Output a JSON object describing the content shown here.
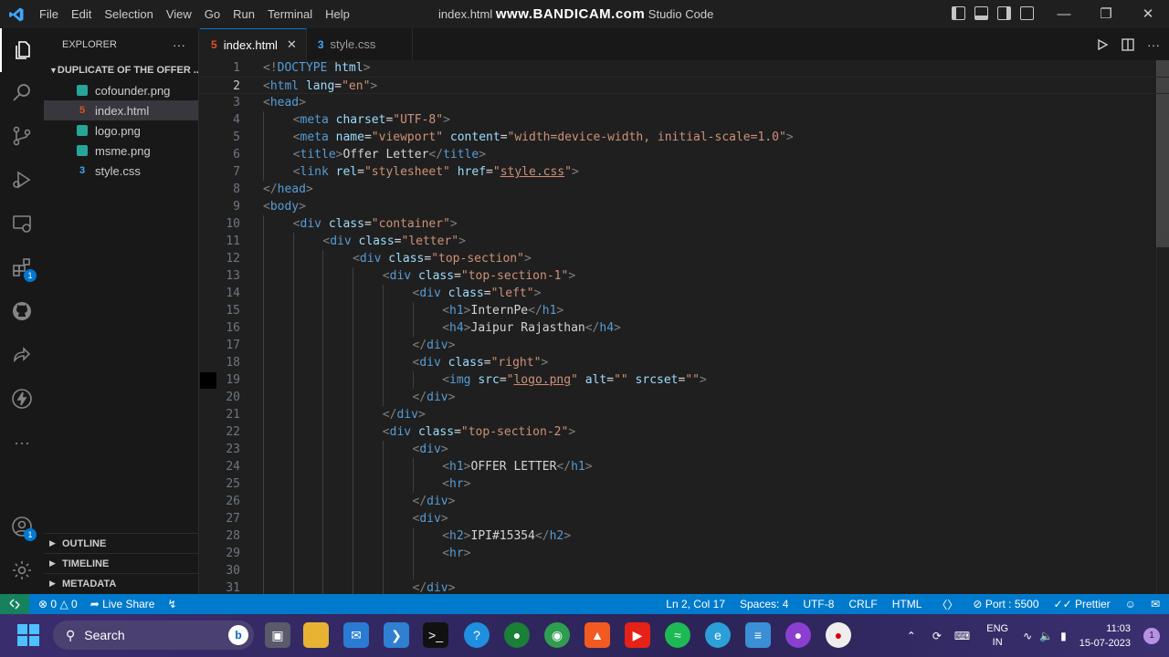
{
  "window": {
    "title_prefix": "index.html",
    "watermark": "www.BANDICAM.com",
    "title_suffix": "Studio Code",
    "menu": [
      "File",
      "Edit",
      "Selection",
      "View",
      "Go",
      "Run",
      "Terminal",
      "Help"
    ]
  },
  "activity": {
    "extensions_badge": "1",
    "accounts_badge": "1"
  },
  "explorer": {
    "header": "EXPLORER",
    "more": "···",
    "folder": "DUPLICATE OF THE OFFER ...",
    "files": [
      {
        "name": "cofounder.png",
        "type": "png"
      },
      {
        "name": "index.html",
        "type": "html"
      },
      {
        "name": "logo.png",
        "type": "png"
      },
      {
        "name": "msme.png",
        "type": "png"
      },
      {
        "name": "style.css",
        "type": "css"
      }
    ],
    "sections": [
      "OUTLINE",
      "TIMELINE",
      "METADATA"
    ]
  },
  "tabs": [
    {
      "label": "index.html",
      "active": true
    },
    {
      "label": "style.css",
      "active": false
    }
  ],
  "editor": {
    "current_line": 2,
    "lines": [
      {
        "n": "1",
        "indent": 0,
        "html": "<span class='b'>&lt;!</span><span class='t'>DOCTYPE</span> <span class='a'>html</span><span class='b'>&gt;</span>"
      },
      {
        "n": "2",
        "indent": 0,
        "html": "<span class='b'>&lt;</span><span class='t'>html</span> <span class='a'>lang</span><span class='w'>=</span><span class='s'>\"en\"</span><span class='b'>&gt;</span>"
      },
      {
        "n": "3",
        "indent": 0,
        "html": "<span class='b'>&lt;</span><span class='t'>head</span><span class='b'>&gt;</span>"
      },
      {
        "n": "4",
        "indent": 1,
        "html": "<span class='b'>&lt;</span><span class='t'>meta</span> <span class='a'>charset</span><span class='w'>=</span><span class='s'>\"UTF-8\"</span><span class='b'>&gt;</span>"
      },
      {
        "n": "5",
        "indent": 1,
        "html": "<span class='b'>&lt;</span><span class='t'>meta</span> <span class='a'>name</span><span class='w'>=</span><span class='s'>\"viewport\"</span> <span class='a'>content</span><span class='w'>=</span><span class='s'>\"width=device-width, initial-scale=1.0\"</span><span class='b'>&gt;</span>"
      },
      {
        "n": "6",
        "indent": 1,
        "html": "<span class='b'>&lt;</span><span class='t'>title</span><span class='b'>&gt;</span><span class='w'>Offer Letter</span><span class='b'>&lt;/</span><span class='t'>title</span><span class='b'>&gt;</span>"
      },
      {
        "n": "7",
        "indent": 1,
        "html": "<span class='b'>&lt;</span><span class='t'>link</span> <span class='a'>rel</span><span class='w'>=</span><span class='s'>\"stylesheet\"</span> <span class='a'>href</span><span class='w'>=</span><span class='s'>\"<span class='u'>style.css</span>\"</span><span class='b'>&gt;</span>"
      },
      {
        "n": "8",
        "indent": 0,
        "html": "<span class='b'>&lt;/</span><span class='t'>head</span><span class='b'>&gt;</span>"
      },
      {
        "n": "9",
        "indent": 0,
        "html": "<span class='b'>&lt;</span><span class='t'>body</span><span class='b'>&gt;</span>"
      },
      {
        "n": "10",
        "indent": 1,
        "html": "<span class='b'>&lt;</span><span class='t'>div</span> <span class='a'>class</span><span class='w'>=</span><span class='s'>\"container\"</span><span class='b'>&gt;</span>"
      },
      {
        "n": "11",
        "indent": 2,
        "html": "<span class='b'>&lt;</span><span class='t'>div</span> <span class='a'>class</span><span class='w'>=</span><span class='s'>\"letter\"</span><span class='b'>&gt;</span>"
      },
      {
        "n": "12",
        "indent": 3,
        "html": "<span class='b'>&lt;</span><span class='t'>div</span> <span class='a'>class</span><span class='w'>=</span><span class='s'>\"top-section\"</span><span class='b'>&gt;</span>"
      },
      {
        "n": "13",
        "indent": 4,
        "html": "<span class='b'>&lt;</span><span class='t'>div</span> <span class='a'>class</span><span class='w'>=</span><span class='s'>\"top-section-1\"</span><span class='b'>&gt;</span>"
      },
      {
        "n": "14",
        "indent": 5,
        "html": "<span class='b'>&lt;</span><span class='t'>div</span> <span class='a'>class</span><span class='w'>=</span><span class='s'>\"left\"</span><span class='b'>&gt;</span>"
      },
      {
        "n": "15",
        "indent": 6,
        "html": "<span class='b'>&lt;</span><span class='t'>h1</span><span class='b'>&gt;</span><span class='w'>InternPe</span><span class='b'>&lt;/</span><span class='t'>h1</span><span class='b'>&gt;</span>"
      },
      {
        "n": "16",
        "indent": 6,
        "html": "<span class='b'>&lt;</span><span class='t'>h4</span><span class='b'>&gt;</span><span class='w'>Jaipur Rajasthan</span><span class='b'>&lt;/</span><span class='t'>h4</span><span class='b'>&gt;</span>"
      },
      {
        "n": "17",
        "indent": 5,
        "html": "<span class='b'>&lt;/</span><span class='t'>div</span><span class='b'>&gt;</span>"
      },
      {
        "n": "18",
        "indent": 5,
        "html": "<span class='b'>&lt;</span><span class='t'>div</span> <span class='a'>class</span><span class='w'>=</span><span class='s'>\"right\"</span><span class='b'>&gt;</span>"
      },
      {
        "n": "19",
        "indent": 6,
        "html": "<span class='b'>&lt;</span><span class='t'>img</span> <span class='a'>src</span><span class='w'>=</span><span class='s'>\"<span class='u'>logo.png</span>\"</span> <span class='a'>alt</span><span class='w'>=</span><span class='s'>\"\"</span> <span class='a'>srcset</span><span class='w'>=</span><span class='s'>\"\"</span><span class='b'>&gt;</span>"
      },
      {
        "n": "20",
        "indent": 5,
        "html": "<span class='b'>&lt;/</span><span class='t'>div</span><span class='b'>&gt;</span>"
      },
      {
        "n": "21",
        "indent": 4,
        "html": "<span class='b'>&lt;/</span><span class='t'>div</span><span class='b'>&gt;</span>"
      },
      {
        "n": "22",
        "indent": 4,
        "html": "<span class='b'>&lt;</span><span class='t'>div</span> <span class='a'>class</span><span class='w'>=</span><span class='s'>\"top-section-2\"</span><span class='b'>&gt;</span>"
      },
      {
        "n": "23",
        "indent": 5,
        "html": "<span class='b'>&lt;</span><span class='t'>div</span><span class='b'>&gt;</span>"
      },
      {
        "n": "24",
        "indent": 6,
        "html": "<span class='b'>&lt;</span><span class='t'>h1</span><span class='b'>&gt;</span><span class='w'>OFFER LETTER</span><span class='b'>&lt;/</span><span class='t'>h1</span><span class='b'>&gt;</span>"
      },
      {
        "n": "25",
        "indent": 6,
        "html": "<span class='b'>&lt;</span><span class='t'>hr</span><span class='b'>&gt;</span>"
      },
      {
        "n": "26",
        "indent": 5,
        "html": "<span class='b'>&lt;/</span><span class='t'>div</span><span class='b'>&gt;</span>"
      },
      {
        "n": "27",
        "indent": 5,
        "html": "<span class='b'>&lt;</span><span class='t'>div</span><span class='b'>&gt;</span>"
      },
      {
        "n": "28",
        "indent": 6,
        "html": "<span class='b'>&lt;</span><span class='t'>h2</span><span class='b'>&gt;</span><span class='w'>IPI#15354</span><span class='b'>&lt;/</span><span class='t'>h2</span><span class='b'>&gt;</span>"
      },
      {
        "n": "29",
        "indent": 6,
        "html": "<span class='b'>&lt;</span><span class='t'>hr</span><span class='b'>&gt;</span>"
      },
      {
        "n": "30",
        "indent": 0,
        "html": ""
      },
      {
        "n": "31",
        "indent": 5,
        "html": "<span class='b'>&lt;/</span><span class='t'>div</span><span class='b'>&gt;</span>"
      }
    ]
  },
  "status": {
    "errors": "0",
    "warnings": "0",
    "live_share": "Live Share",
    "position": "Ln 2, Col 17",
    "spaces": "Spaces: 4",
    "encoding": "UTF-8",
    "eol": "CRLF",
    "language": "HTML",
    "port": "Port : 5500",
    "prettier": "Prettier"
  },
  "taskbar": {
    "search": "Search",
    "lang_top": "ENG",
    "lang_bottom": "IN",
    "time": "11:03",
    "date": "15-07-2023",
    "notifications": "1"
  }
}
